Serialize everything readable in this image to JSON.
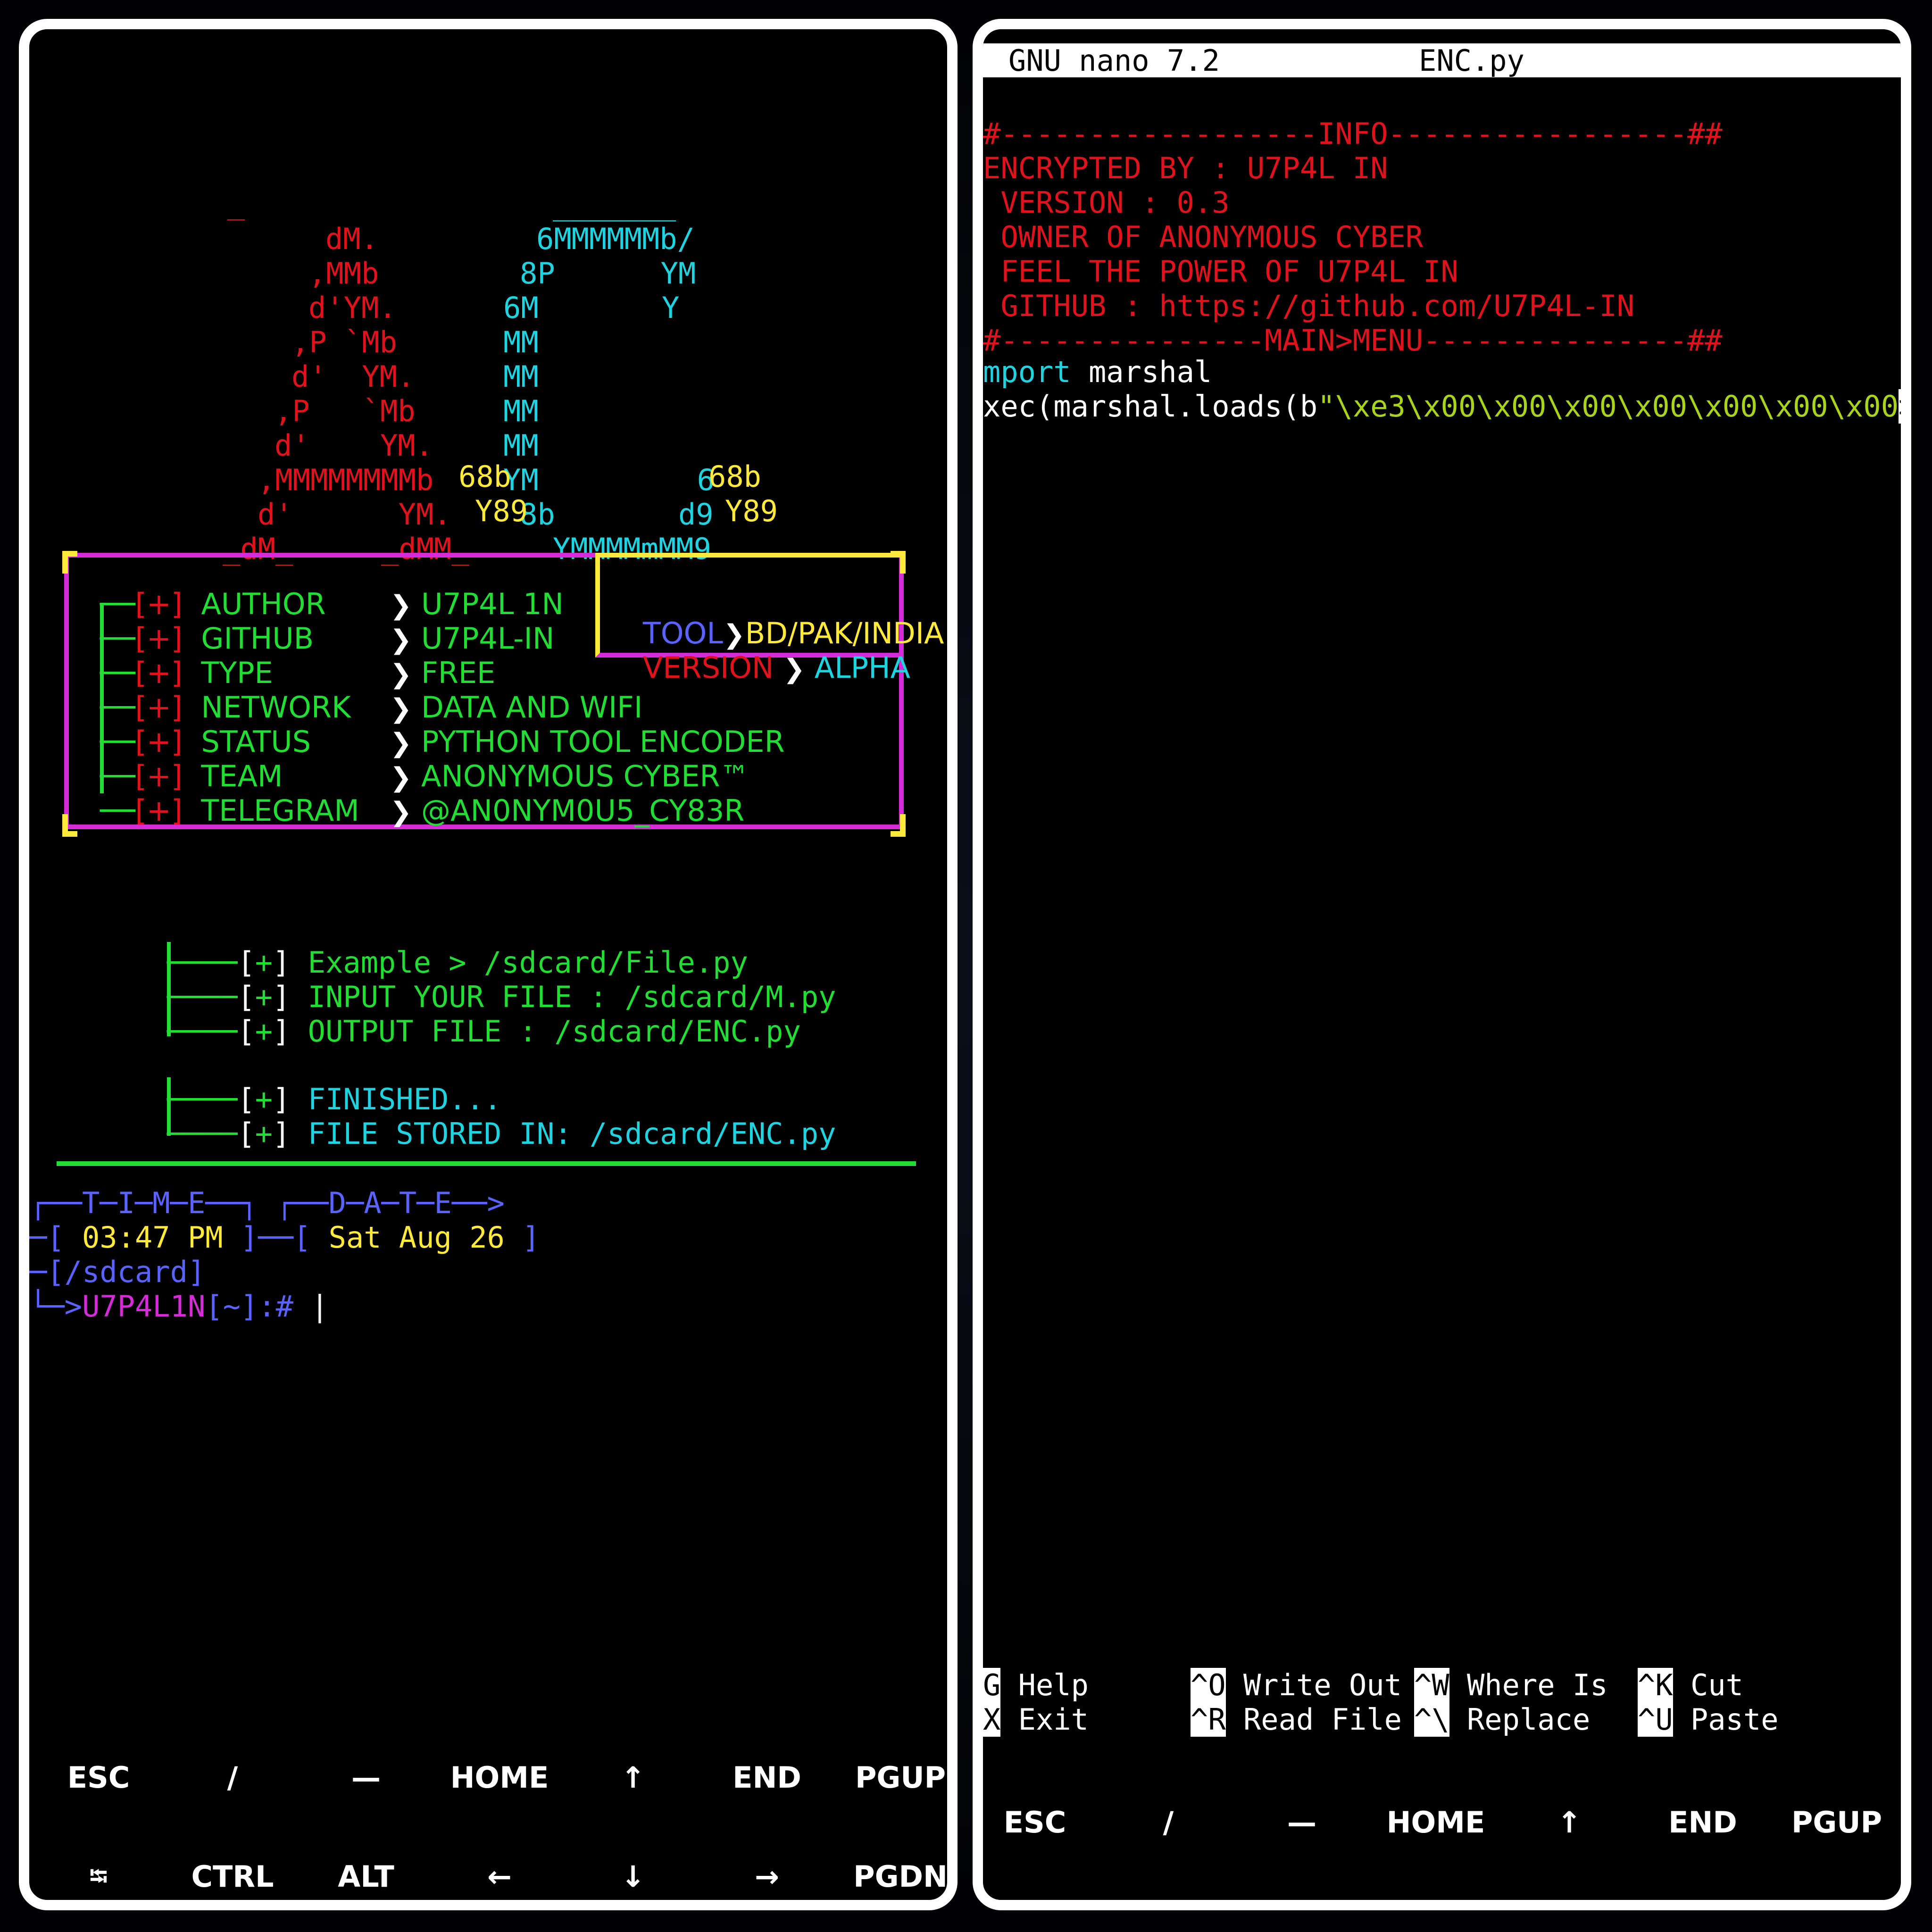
{
  "left": {
    "banner": {
      "red_lines": [
        "_",
        "dM.",
        ",MMb",
        "d'YM.",
        ",P `Mb",
        "d'  YM.",
        ",P   `Mb",
        "d'    YM.",
        ",MMMMMMMMb",
        "d'      YM.",
        "_dM_     _dMM_"
      ],
      "cyan_lines": [
        "_______",
        "6MMMMMMb/",
        "8P      YM",
        "6M       Y",
        "MM",
        "MM",
        "MM",
        "MM",
        "YM         6",
        "8b       d9",
        "YMMMMmMM9"
      ],
      "yellow_parts": [
        "68b",
        "68b",
        "Y89",
        "Y89"
      ]
    },
    "info": {
      "rows": [
        {
          "key": "AUTHOR",
          "value": "U7P4L 1N"
        },
        {
          "key": "GITHUB",
          "value": "U7P4L-IN"
        },
        {
          "key": "TYPE",
          "value": "FREE"
        },
        {
          "key": "NETWORK",
          "value": "DATA AND WIFI"
        },
        {
          "key": "STATUS",
          "value": "PYTHON TOOL ENCODER"
        },
        {
          "key": "TEAM",
          "value": "ANONYMOUS CYBER™"
        },
        {
          "key": "TELEGRAM",
          "value": "@AN0NYM0U5_CY83R"
        }
      ],
      "bullet": "[+]",
      "tool_label": "TOOL",
      "tool_value": "BD/PAK/INDIA",
      "version_label": "VERSION",
      "version_value": "ALPHA"
    },
    "steps": {
      "example": "Example > /sdcard/File.py",
      "input": "INPUT YOUR FILE : /sdcard/M.py",
      "output": "OUTPUT FILE : /sdcard/ENC.py",
      "finished": "FINISHED...",
      "stored": "FILE STORED IN: /sdcard/ENC.py"
    },
    "prompt": {
      "time_header": "┌──T─I─M─E──┐ ┌──D─A─T─E──>",
      "time_open": "─[",
      "time": "03:47 PM",
      "mid": "]──[",
      "date": "Sat Aug 26",
      "date_close": "]",
      "dir": "─[/sdcard]",
      "user": "U7P4L1N",
      "path": "[~]:#",
      "cursor": "|"
    }
  },
  "right": {
    "nano_title": "GNU nano 7.2",
    "file_name": "ENC.py",
    "lines": [
      "#------------------INFO-----------------##",
      "ENCRYPTED BY : U7P4L IN",
      " VERSION : 0.3",
      " OWNER OF ANONYMOUS CYBER",
      " FEEL THE POWER OF U7P4L IN",
      " GITHUB : https://github.com/U7P4L-IN",
      "#---------------MAIN>MENU---------------##"
    ],
    "code_kw1": "mport",
    "code_rest1": " marshal",
    "code_l2_prefix": "xec(marshal.loads(b",
    "code_l2_str": "\"\\xe3\\x00\\x00\\x00\\x00\\x00\\x00\\x00",
    "code_l2_more": ">",
    "shortcuts": [
      {
        "key": "G",
        "label": "Help"
      },
      {
        "key": "^O",
        "label": "Write Out"
      },
      {
        "key": "^W",
        "label": "Where Is"
      },
      {
        "key": "^K",
        "label": "Cut"
      },
      {
        "key": "X",
        "label": "Exit"
      },
      {
        "key": "^R",
        "label": "Read File"
      },
      {
        "key": "^\\",
        "label": "Replace"
      },
      {
        "key": "^U",
        "label": "Paste"
      }
    ]
  },
  "extra_keys": {
    "row1": [
      "ESC",
      "/",
      "—",
      "HOME",
      "↑",
      "END",
      "PGUP"
    ],
    "row2": [
      "⭾",
      "CTRL",
      "ALT",
      "←",
      "↓",
      "→",
      "PGDN"
    ]
  }
}
